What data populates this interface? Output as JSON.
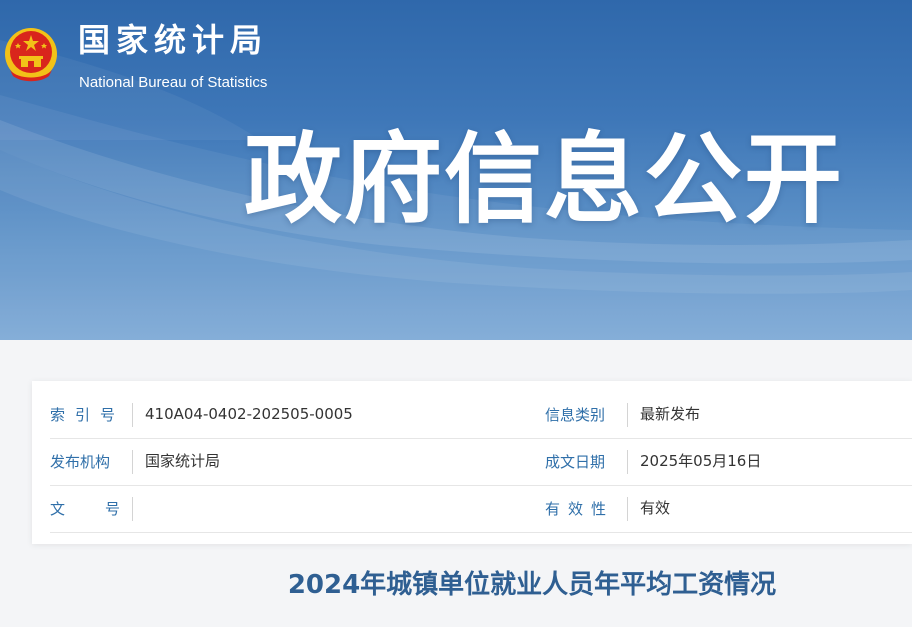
{
  "header": {
    "org_name_cn": "国家统计局",
    "org_name_en": "National Bureau of Statistics",
    "section_title": "政府信息公开"
  },
  "info": {
    "rows": [
      {
        "label_left": "索引号",
        "value_left": "410A04-0402-202505-0005",
        "label_right": "信息类别",
        "value_right": "最新发布"
      },
      {
        "label_left": "发布机构",
        "value_left": "国家统计局",
        "label_right": "成文日期",
        "value_right": "2025年05月16日"
      },
      {
        "label_left": "文号",
        "value_left": "",
        "label_right": "有效性",
        "value_right": "有效"
      }
    ]
  },
  "article": {
    "title": "2024年城镇单位就业人员年平均工资情况"
  },
  "colors": {
    "banner_blue": "#2f68ab",
    "label_blue": "#2f6fa9",
    "title_blue": "#2f5f92",
    "emblem_red": "#d9251c",
    "emblem_gold": "#f2c218"
  }
}
